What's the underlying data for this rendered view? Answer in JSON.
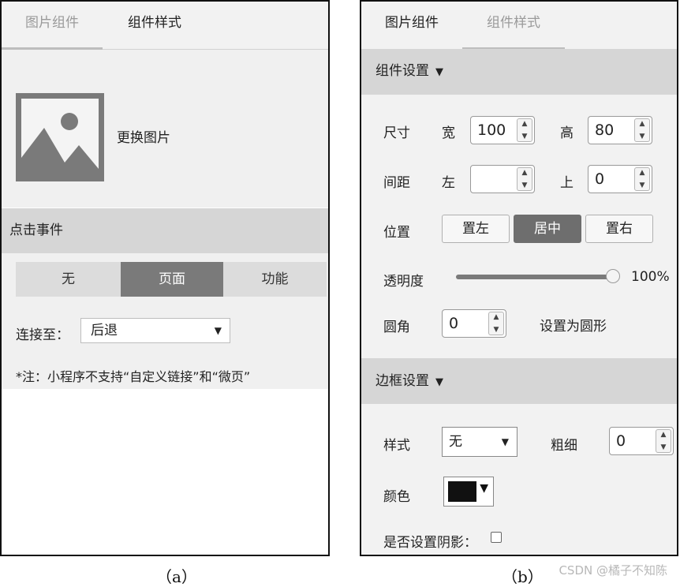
{
  "panel_a": {
    "tabs": [
      "图片组件",
      "组件样式"
    ],
    "active_tab": 0,
    "image_action": "更换图片",
    "click_event": {
      "title": "点击事件",
      "options": [
        "无",
        "页面",
        "功能"
      ],
      "selected": "页面"
    },
    "link": {
      "label": "连接至：",
      "value": "后退"
    },
    "note": "*注：小程序不支持“自定义链接”和“微页”"
  },
  "panel_b": {
    "tabs": [
      "图片组件",
      "组件样式"
    ],
    "active_tab": 0,
    "component_settings": {
      "title": "组件设置",
      "size": {
        "label": "尺寸",
        "width_label": "宽",
        "width": "100",
        "height_label": "高",
        "height": "80"
      },
      "spacing": {
        "label": "间距",
        "left_label": "左",
        "left": "",
        "top_label": "上",
        "top": "0"
      },
      "position": {
        "label": "位置",
        "options": [
          "置左",
          "居中",
          "置右"
        ],
        "selected": "居中"
      },
      "opacity": {
        "label": "透明度",
        "value_text": "100%",
        "value": 100
      },
      "radius": {
        "label": "圆角",
        "value": "0",
        "action": "设置为圆形"
      }
    },
    "border_settings": {
      "title": "边框设置",
      "style": {
        "label": "样式",
        "value": "无"
      },
      "thickness": {
        "label": "粗细",
        "value": "0"
      },
      "color": {
        "label": "颜色",
        "value": "#111111"
      },
      "shadow": {
        "label": "是否设置阴影：",
        "checked": false
      }
    }
  },
  "captions": {
    "a": "（a）",
    "b": "（b）"
  },
  "watermark": "CSDN @橘子不知陈"
}
